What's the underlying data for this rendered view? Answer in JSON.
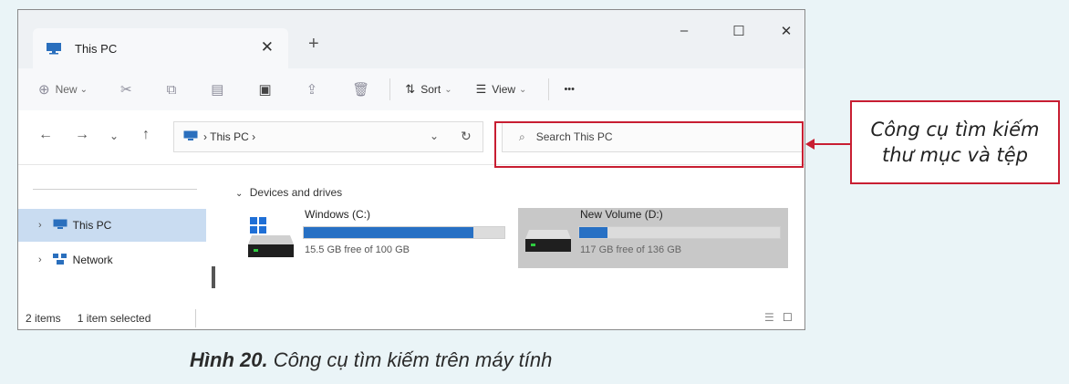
{
  "window": {
    "tab_title": "This PC",
    "controls": {
      "minimize": "–",
      "maximize": "☐",
      "close": "✕"
    }
  },
  "toolbar": {
    "new_label": "New",
    "sort_label": "Sort",
    "view_label": "View",
    "more_label": "•••"
  },
  "address": {
    "path": "› This PC ›",
    "search_placeholder": "Search This PC"
  },
  "sidebar": {
    "items": [
      {
        "label": "This PC",
        "selected": true
      },
      {
        "label": "Network",
        "selected": false
      }
    ]
  },
  "content": {
    "group_label": "Devices and drives",
    "drives": [
      {
        "name": "Windows (C:)",
        "free": "15.5 GB free of 100 GB",
        "used_fraction": 0.845,
        "selected": false
      },
      {
        "name": "New Volume (D:)",
        "free": "117 GB free of 136 GB",
        "used_fraction": 0.14,
        "selected": true
      }
    ]
  },
  "status": {
    "items": "2 items",
    "selected": "1 item selected"
  },
  "callout": {
    "line1": "Công cụ tìm kiếm",
    "line2": "thư mục và tệp"
  },
  "caption": {
    "figure": "Hình 20.",
    "text": "Công cụ tìm kiếm trên máy tính"
  },
  "colors": {
    "accent": "#c81e32",
    "drive_bar": "#2770c4",
    "selection": "#c9dcf1"
  }
}
